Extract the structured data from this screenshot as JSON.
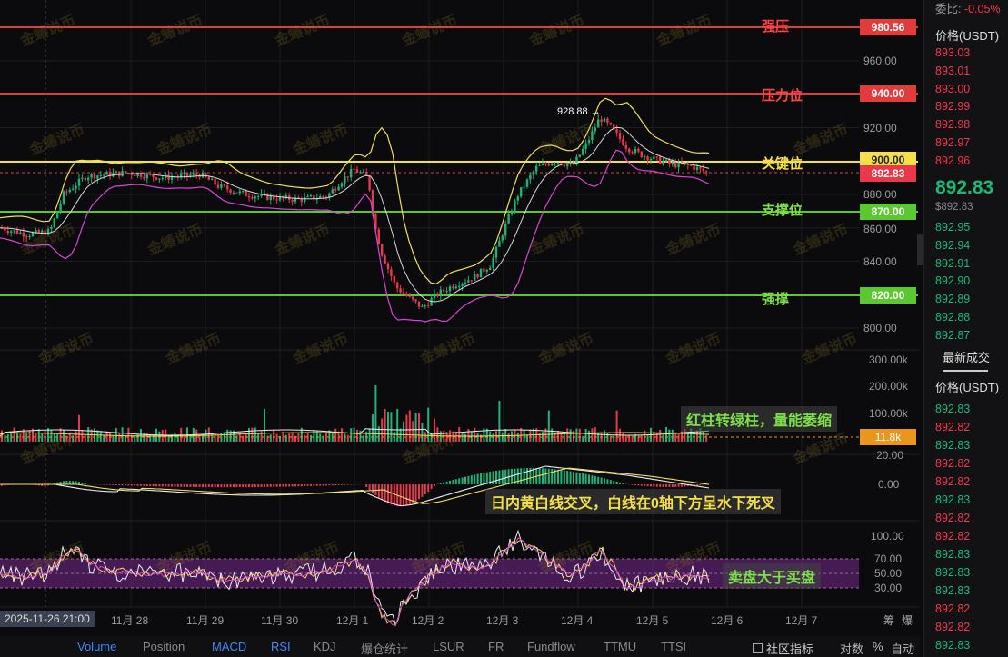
{
  "levels": {
    "strong_resistance": {
      "label": "强压",
      "price": "980.56",
      "color": "#e23b3b"
    },
    "resistance": {
      "label": "压力位",
      "price": "940.00",
      "color": "#e23b3b"
    },
    "key": {
      "label": "关键位",
      "price": "900.00",
      "color": "#f5e04a"
    },
    "current": {
      "price": "892.83"
    },
    "support": {
      "label": "支撑位",
      "price": "870.00",
      "color": "#5bc832"
    },
    "strong_support": {
      "label": "强撑",
      "price": "820.00",
      "color": "#5bc832"
    }
  },
  "price_axis": [
    "960.00",
    "920.00",
    "880.00",
    "860.00",
    "840.00",
    "800.00"
  ],
  "high_marker": "928.88 →",
  "volume_axis": [
    "300.00k",
    "200.00k",
    "100.00k",
    "20.00"
  ],
  "volume_current": "11.8k",
  "macd_axis": "0.00",
  "rsi_axis": [
    "100.00",
    "70.00",
    "50.00",
    "30.00"
  ],
  "annotations": {
    "volume": "红柱转绿柱，量能萎缩",
    "macd": "日内黄白线交叉，白线在0轴下方呈水下死叉",
    "rsi": "卖盘大于买盘"
  },
  "time_axis": {
    "current": "2025-11-26 21:00",
    "dates": [
      "11月 28",
      "11月 29",
      "11月 30",
      "12月 1",
      "12月 2",
      "12月 3",
      "12月 4",
      "12月 5",
      "12月 6",
      "12月 7"
    ]
  },
  "toolbar": {
    "items": [
      "Volume",
      "Position",
      "MACD",
      "RSI",
      "KDJ",
      "爆仓统计",
      "LSUR",
      "FR",
      "Fundflow",
      "TTMU",
      "TTSI"
    ],
    "active": [
      "Volume",
      "MACD",
      "RSI"
    ],
    "community": "社区指标",
    "log": "对数",
    "percent": "%",
    "auto": "自动",
    "chip": "筹",
    "liq": "爆"
  },
  "right_panel": {
    "ratio_label": "委比:",
    "ratio_value": "-0.05%",
    "price_header": "价格(USDT)",
    "asks": [
      "893.03",
      "893.01",
      "893.00",
      "892.99",
      "892.98",
      "892.97",
      "892.96"
    ],
    "last_price": "892.83",
    "last_price_usd": "$892.83",
    "bids": [
      "892.95",
      "892.94",
      "892.91",
      "892.90",
      "892.89",
      "892.88",
      "892.87"
    ],
    "trades_title": "最新成交",
    "trades_header": "价格(USDT)",
    "trades": [
      {
        "price": "892.83",
        "side": "buy"
      },
      {
        "price": "892.82",
        "side": "sell"
      },
      {
        "price": "892.83",
        "side": "buy"
      },
      {
        "price": "892.82",
        "side": "sell"
      },
      {
        "price": "892.82",
        "side": "sell"
      },
      {
        "price": "892.83",
        "side": "buy"
      },
      {
        "price": "892.82",
        "side": "sell"
      },
      {
        "price": "892.82",
        "side": "sell"
      },
      {
        "price": "892.83",
        "side": "buy"
      },
      {
        "price": "892.83",
        "side": "buy"
      },
      {
        "price": "892.83",
        "side": "buy"
      },
      {
        "price": "892.82",
        "side": "sell"
      },
      {
        "price": "892.82",
        "side": "sell"
      },
      {
        "price": "892.83",
        "side": "buy"
      }
    ]
  },
  "watermark": "金蝽说币"
}
